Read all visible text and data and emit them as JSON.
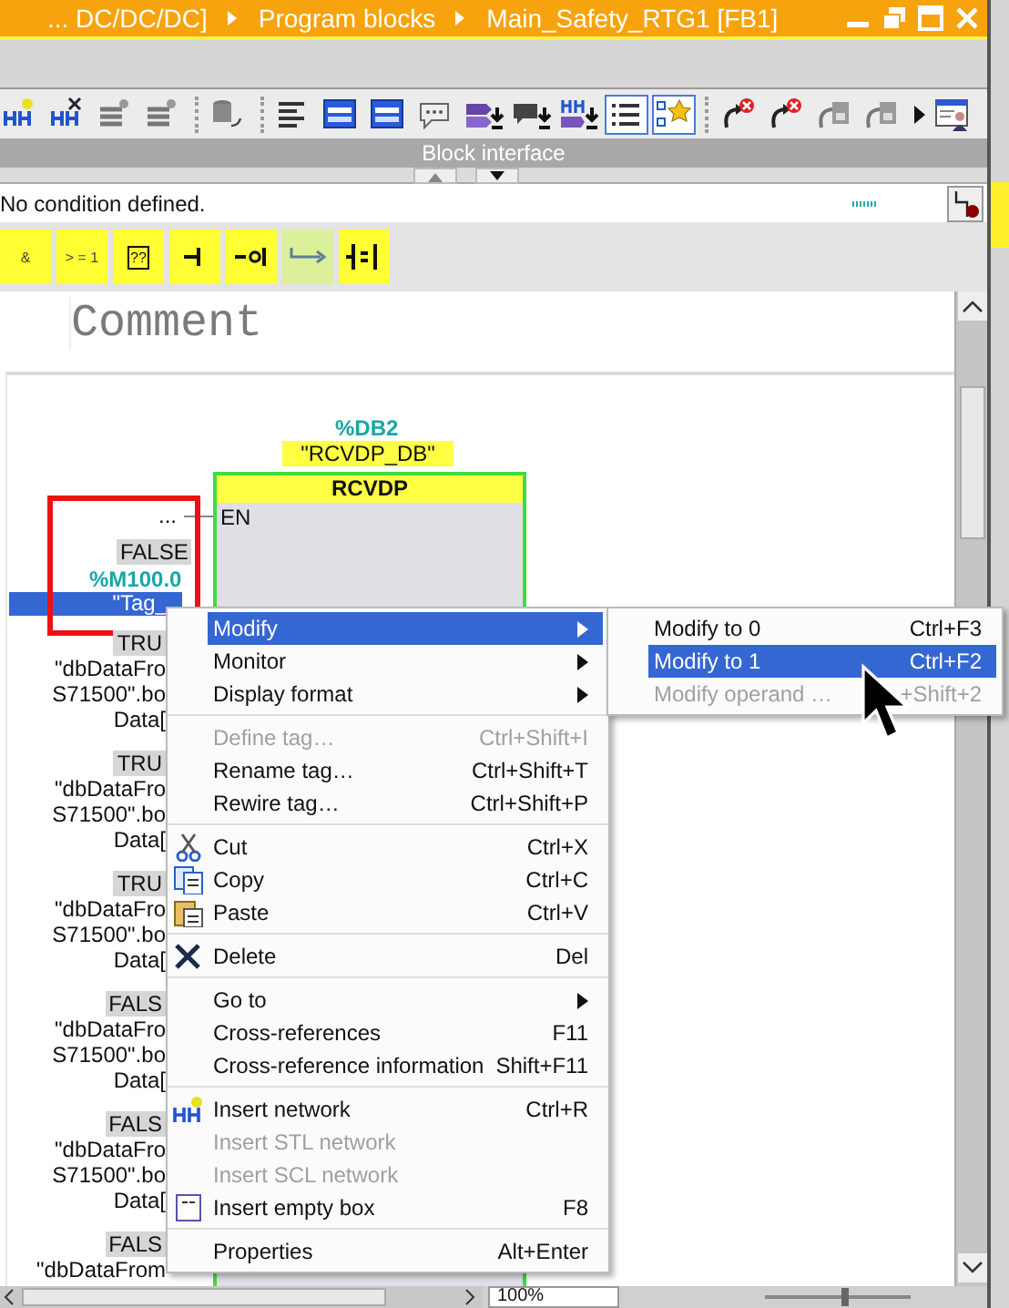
{
  "title_bar": {
    "path": [
      "... DC/DC/DC]",
      "Program blocks",
      "Main_Safety_RTG1 [FB1]"
    ]
  },
  "toolbar": {
    "groups": [
      [
        {
          "kind": "network-star",
          "on": false
        },
        {
          "kind": "network-x",
          "on": false
        },
        {
          "kind": "lines-star",
          "on": false
        },
        {
          "kind": "lines-star",
          "on": false
        }
      ],
      [
        {
          "kind": "database",
          "on": false
        }
      ],
      [
        {
          "kind": "lines",
          "on": false
        },
        {
          "kind": "window",
          "on": false
        },
        {
          "kind": "window",
          "on": false
        },
        {
          "kind": "bubble",
          "on": false
        },
        {
          "kind": "tag-down",
          "on": false
        },
        {
          "kind": "bubble-down",
          "on": false
        },
        {
          "kind": "network-down",
          "on": false
        },
        {
          "kind": "list",
          "on": true
        },
        {
          "kind": "star-list",
          "on": true
        }
      ],
      [
        {
          "kind": "arrow-x",
          "on": false
        },
        {
          "kind": "arrow-x",
          "on": false
        },
        {
          "kind": "monitor",
          "on": false
        },
        {
          "kind": "monitor",
          "on": false
        },
        {
          "kind": "more",
          "on": false
        },
        {
          "kind": "person-window",
          "on": false
        }
      ]
    ]
  },
  "block_interface": {
    "title": "Block interface"
  },
  "condition": {
    "text": "No condition defined."
  },
  "palette": [
    {
      "kind": "text",
      "label": "&",
      "disabled": false
    },
    {
      "kind": "text",
      "label": "> = 1",
      "disabled": false
    },
    {
      "kind": "box",
      "label": "??",
      "disabled": false
    },
    {
      "kind": "contact",
      "disabled": false
    },
    {
      "kind": "negated",
      "disabled": false
    },
    {
      "kind": "branch",
      "disabled": true
    },
    {
      "kind": "assign",
      "disabled": false
    }
  ],
  "network": {
    "comment": "Comment",
    "block": {
      "instance_address": "%DB2",
      "instance_name": "\"RCVDP_DB\"",
      "type": "RCVDP",
      "pin": "EN"
    },
    "en_operand": "...",
    "operand": {
      "value": "FALSE",
      "address": "%M100.0",
      "name": "\"Tag_",
      "selected": true
    },
    "inputs": [
      {
        "value": "TRU",
        "lines": [
          "\"dbDataFro",
          "S71500\".bo",
          "Data["
        ]
      },
      {
        "value": "TRU",
        "lines": [
          "\"dbDataFro",
          "S71500\".bo",
          "Data["
        ]
      },
      {
        "value": "TRU",
        "lines": [
          "\"dbDataFro",
          "S71500\".bo",
          "Data["
        ]
      },
      {
        "value": "FALS",
        "lines": [
          "\"dbDataFro",
          "S71500\".bo",
          "Data["
        ]
      },
      {
        "value": "FALS",
        "lines": [
          "\"dbDataFro",
          "S71500\".bo",
          "Data["
        ]
      },
      {
        "value": "FALS",
        "lines": [
          "\"dbDataFrom"
        ]
      }
    ]
  },
  "context_menu": {
    "sections": [
      [
        {
          "label": "Modify",
          "submenu": true,
          "selected": true,
          "disabled": false
        },
        {
          "label": "Monitor",
          "submenu": true,
          "selected": false,
          "disabled": false
        },
        {
          "label": "Display format",
          "submenu": true,
          "selected": false,
          "disabled": false
        }
      ],
      [
        {
          "label": "Define tag…",
          "shortcut": "Ctrl+Shift+I",
          "submenu": false,
          "selected": false,
          "disabled": true
        },
        {
          "label": "Rename tag…",
          "shortcut": "Ctrl+Shift+T",
          "submenu": false,
          "selected": false,
          "disabled": false
        },
        {
          "label": "Rewire tag…",
          "shortcut": "Ctrl+Shift+P",
          "submenu": false,
          "selected": false,
          "disabled": false
        }
      ],
      [
        {
          "label": "Cut",
          "shortcut": "Ctrl+X",
          "kind": "cut",
          "submenu": false,
          "selected": false,
          "disabled": false
        },
        {
          "label": "Copy",
          "shortcut": "Ctrl+C",
          "kind": "copy",
          "submenu": false,
          "selected": false,
          "disabled": false
        },
        {
          "label": "Paste",
          "shortcut": "Ctrl+V",
          "kind": "paste",
          "submenu": false,
          "selected": false,
          "disabled": false
        }
      ],
      [
        {
          "label": "Delete",
          "shortcut": "Del",
          "kind": "delete",
          "submenu": false,
          "selected": false,
          "disabled": false
        }
      ],
      [
        {
          "label": "Go to",
          "submenu": true,
          "selected": false,
          "disabled": false
        },
        {
          "label": "Cross-references",
          "shortcut": "F11",
          "submenu": false,
          "selected": false,
          "disabled": false
        },
        {
          "label": "Cross-reference information",
          "shortcut": "Shift+F11",
          "submenu": false,
          "selected": false,
          "disabled": false
        }
      ],
      [
        {
          "label": "Insert network",
          "shortcut": "Ctrl+R",
          "kind": "network",
          "submenu": false,
          "selected": false,
          "disabled": false
        },
        {
          "label": "Insert STL network",
          "submenu": false,
          "selected": false,
          "disabled": true
        },
        {
          "label": "Insert SCL network",
          "submenu": false,
          "selected": false,
          "disabled": true
        },
        {
          "label": "Insert empty box",
          "shortcut": "F8",
          "kind": "box",
          "submenu": false,
          "selected": false,
          "disabled": false
        }
      ],
      [
        {
          "label": "Properties",
          "shortcut": "Alt+Enter",
          "submenu": false,
          "selected": false,
          "disabled": false
        }
      ]
    ]
  },
  "submenu": {
    "items": [
      {
        "label": "Modify to 0",
        "shortcut": "Ctrl+F3",
        "selected": false,
        "disabled": false
      },
      {
        "label": "Modify to 1",
        "shortcut": "Ctrl+F2",
        "selected": true,
        "disabled": false
      },
      {
        "label": "Modify operand …",
        "shortcut": "+Shift+2",
        "selected": false,
        "disabled": true
      }
    ]
  },
  "zoom": {
    "value": "100%",
    "level": 0.55
  }
}
